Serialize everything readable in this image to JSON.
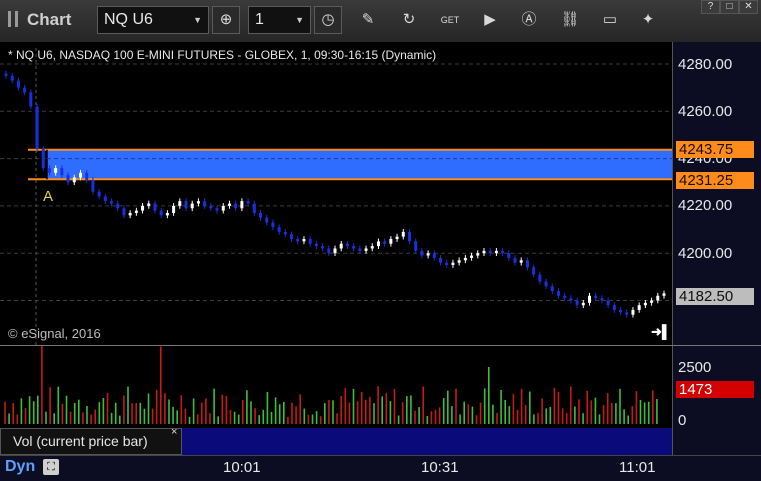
{
  "window": {
    "title": "Chart",
    "buttons": [
      "?",
      "□",
      "✕"
    ]
  },
  "toolbar": {
    "symbol": "NQ U6",
    "interval": "1",
    "icons": [
      "target-icon",
      "clock-icon",
      "pencil-icon",
      "refresh-icon",
      "get-icon",
      "play-icon",
      "alert-icon",
      "link-icon",
      "chat-icon",
      "twitter-icon"
    ]
  },
  "chart": {
    "header": "* NQ U6, NASDAQ 100 E-MINI FUTURES - GLOBEX, 1, 09:30-16:15 (Dynamic)",
    "copyright": "© eSignal, 2016",
    "marker": "A",
    "price_ticks": [
      "4280.00",
      "4260.00",
      "4240.00",
      "4220.00",
      "4200.00",
      "4180.00"
    ],
    "upper_level": "4243.75",
    "lower_level": "4231.25",
    "last_price": "4182.50",
    "colors": {
      "box": "#2f6dff",
      "level": "#ff8c1a",
      "up": "#ffffff",
      "down": "#1a2fe0"
    }
  },
  "volume": {
    "ticks": [
      "2500",
      "0"
    ],
    "last": "1473",
    "study_label": "Vol (current price bar)",
    "close": "×"
  },
  "time_axis": {
    "labels": [
      "10:01",
      "10:31",
      "11:01"
    ],
    "mode": "Dyn"
  },
  "chart_data": {
    "type": "candlestick",
    "title": "* NQ U6, NASDAQ 100 E-MINI FUTURES - GLOBEX, 1, 09:30-16:15 (Dynamic)",
    "y_range": [
      4172,
      4292
    ],
    "closes": [
      4275,
      4273,
      4270,
      4268,
      4262,
      4244,
      4236,
      4234,
      4236,
      4233,
      4230,
      4232,
      4234,
      4231,
      4226,
      4224,
      4222,
      4221,
      4219,
      4216,
      4217,
      4218,
      4220,
      4221,
      4218,
      4216,
      4217,
      4220,
      4222,
      4219,
      4221,
      4222,
      4220,
      4219,
      4218,
      4220,
      4221,
      4219,
      4222,
      4221,
      4217,
      4215,
      4213,
      4211,
      4209,
      4208,
      4206,
      4205,
      4206,
      4204,
      4203,
      4202,
      4200,
      4202,
      4204,
      4203,
      4202,
      4201,
      4202,
      4203,
      4205,
      4204,
      4206,
      4207,
      4209,
      4205,
      4201,
      4199,
      4200,
      4198,
      4196,
      4195,
      4196,
      4197,
      4198,
      4199,
      4200,
      4201,
      4200,
      4201,
      4200,
      4198,
      4196,
      4197,
      4194,
      4191,
      4188,
      4186,
      4184,
      4182,
      4181,
      4180,
      4178,
      4179,
      4182,
      4181,
      4180,
      4178,
      4176,
      4175,
      4174,
      4176,
      4178,
      4179,
      4180,
      4182,
      4183
    ],
    "volumes_note": "Volume histogram, axis 0-2500, last bar 1473"
  }
}
